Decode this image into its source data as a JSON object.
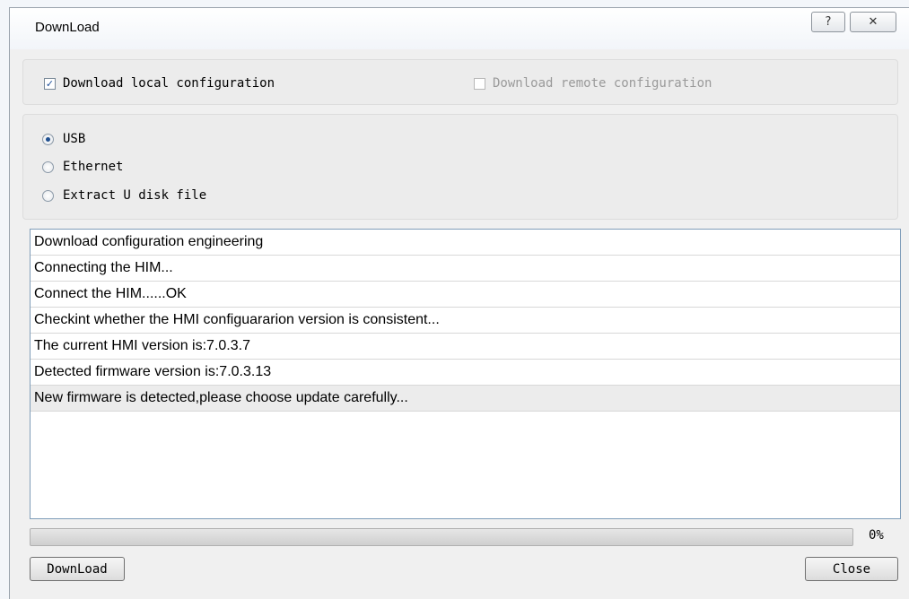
{
  "dialog": {
    "title": "DownLoad",
    "help_symbol": "?",
    "close_symbol": "✕"
  },
  "config": {
    "local": {
      "label": "Download local configuration",
      "checked": true
    },
    "remote": {
      "label": "Download remote configuration",
      "checked": false,
      "disabled": true
    }
  },
  "connection": {
    "options": [
      {
        "label": "USB",
        "selected": true
      },
      {
        "label": "Ethernet",
        "selected": false
      },
      {
        "label": "Extract U disk file",
        "selected": false
      }
    ]
  },
  "log": {
    "lines": [
      "Download configuration engineering",
      "Connecting the HIM...",
      "Connect the HIM......OK",
      "Checkint whether the HMI configuararion version is consistent...",
      "The current HMI version is:7.0.3.7",
      "Detected firmware version is:7.0.3.13",
      "New firmware is detected,please choose update carefully..."
    ],
    "selected_index": 6
  },
  "progress": {
    "value": 0,
    "label": "0%"
  },
  "buttons": {
    "download": "DownLoad",
    "close": "Close"
  }
}
